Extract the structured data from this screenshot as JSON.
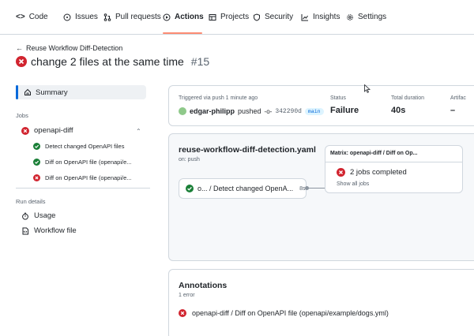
{
  "nav": {
    "code": "Code",
    "issues": "Issues",
    "pull_requests": "Pull requests",
    "actions": "Actions",
    "projects": "Projects",
    "security": "Security",
    "insights": "Insights",
    "settings": "Settings"
  },
  "header": {
    "back_label": "Reuse Workflow Diff-Detection",
    "title": "change 2 files at the same time",
    "run_number": "#15"
  },
  "sidebar": {
    "summary": "Summary",
    "jobs_heading": "Jobs",
    "job_name": "openapi-diff",
    "steps": [
      {
        "label": "Detect changed OpenAPI files",
        "status": "success"
      },
      {
        "label": "Diff on OpenAPI file (openapi/e...",
        "status": "success"
      },
      {
        "label": "Diff on OpenAPI file (openapi/e...",
        "status": "failure"
      }
    ],
    "run_details_heading": "Run details",
    "usage": "Usage",
    "workflow_file": "Workflow file"
  },
  "summary_panel": {
    "triggered": "Triggered via push 1 minute ago",
    "user": "edgar-philipp",
    "action": "pushed",
    "commit": "342290d",
    "branch": "main",
    "status_label": "Status",
    "status_value": "Failure",
    "duration_label": "Total duration",
    "duration_value": "40s",
    "artifacts_label": "Artifac",
    "artifacts_value": "–"
  },
  "graph_panel": {
    "workflow": "reuse-workflow-diff-detection.yaml",
    "trigger": "on: push",
    "job_node_label": "o... / Detect changed OpenA...",
    "job_node_duration": "8s",
    "matrix_title": "Matrix: openapi-diff / Diff on Op...",
    "matrix_status": "2 jobs completed",
    "matrix_link": "Show all jobs"
  },
  "annotations": {
    "title": "Annotations",
    "count": "1 error",
    "item": "openapi-diff / Diff on OpenAPI file (openapi/example/dogs.yml)"
  },
  "colors": {
    "failure": "#d1242f",
    "success": "#1a7f37",
    "accent_underline": "#fd8c73",
    "link": "#0969da"
  }
}
